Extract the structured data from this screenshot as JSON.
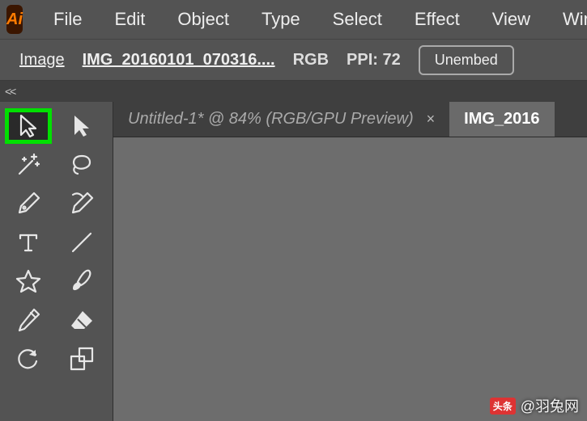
{
  "app": {
    "logo_text": "Ai"
  },
  "menu": [
    "File",
    "Edit",
    "Object",
    "Type",
    "Select",
    "Effect",
    "View",
    "Wir"
  ],
  "control": {
    "label": "Image",
    "filename": "IMG_20160101_070316....",
    "color_mode": "RGB",
    "ppi": "PPI: 72",
    "unembed": "Unembed"
  },
  "collapse": "<<",
  "tabs": [
    {
      "label": "Untitled-1* @ 84% (RGB/GPU Preview)",
      "active": false,
      "close": "×"
    },
    {
      "label": "IMG_2016",
      "active": true
    }
  ],
  "tools": [
    {
      "name": "selection-tool",
      "highlight": true
    },
    {
      "name": "direct-selection-tool"
    },
    {
      "name": "magic-wand-tool"
    },
    {
      "name": "lasso-tool"
    },
    {
      "name": "pen-tool"
    },
    {
      "name": "curvature-tool"
    },
    {
      "name": "type-tool"
    },
    {
      "name": "line-segment-tool"
    },
    {
      "name": "star-tool"
    },
    {
      "name": "paintbrush-tool"
    },
    {
      "name": "pencil-tool"
    },
    {
      "name": "eraser-tool"
    },
    {
      "name": "rotate-tool"
    },
    {
      "name": "scale-tool"
    }
  ],
  "watermark": {
    "badge": "头条",
    "text": "@羽兔网"
  }
}
